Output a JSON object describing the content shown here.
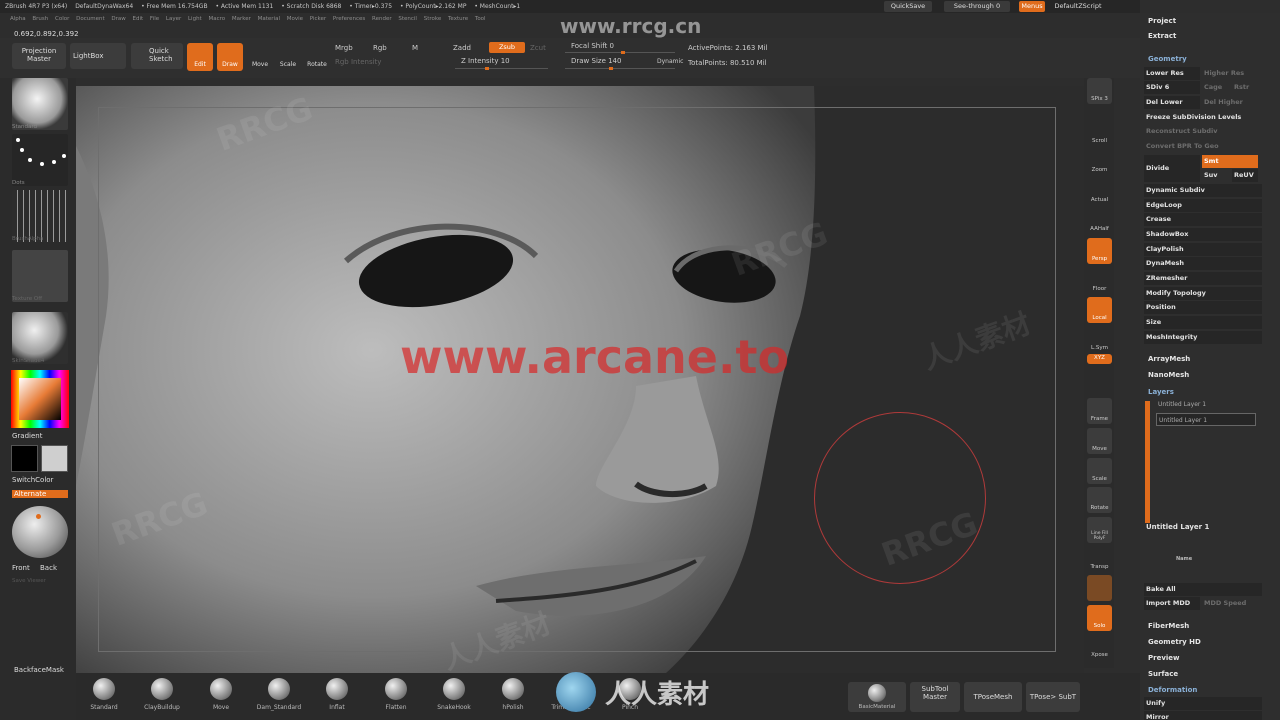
{
  "menubar": {
    "title": "ZBrush 4R7 P3 (x64)",
    "doc": "DefaultDynaWax64",
    "info": [
      "• Free Mem 16.754GB",
      "• Active Mem 1131",
      "• Scratch Disk 6868",
      "• Timer▸0.375",
      "• PolyCount▸2.162 MP",
      "• MeshCount▸1"
    ],
    "menus": [
      "Alpha",
      "Brush",
      "Color",
      "Document",
      "Draw",
      "Edit",
      "File",
      "Layer",
      "Light",
      "Macro",
      "Marker",
      "Material",
      "Movie",
      "Picker",
      "Preferences",
      "Render",
      "Stencil",
      "Stroke",
      "Texture",
      "Tool"
    ],
    "quicksave": "QuickSave",
    "seethrough": "See-through  0",
    "menus_btn": "Menus",
    "defaultzscript": "DefaultZScript"
  },
  "coords": "0.692,0.892,0.392",
  "toolbar": {
    "projection": "Projection Master",
    "lightbox": "LightBox",
    "quicksketch": "Quick Sketch",
    "edit": "Edit",
    "draw": "Draw",
    "move": "Move",
    "scale": "Scale",
    "rotate": "Rotate",
    "mrgb": "Mrgb",
    "rgb": "Rgb",
    "m": "M",
    "rgb_intensity": "Rgb Intensity",
    "zadd": "Zadd",
    "zsub": "Zsub",
    "zcut": "Zcut",
    "z_intensity": "Z Intensity 10",
    "focal": "Focal Shift 0",
    "drawsize": "Draw Size 140",
    "dynamic": "Dynamic",
    "active_points": "ActivePoints: 2.163  Mil",
    "total_points": "TotalPoints: 80.510  Mil"
  },
  "left": {
    "brush": "Standard",
    "stroke": "Dots",
    "alpha": "BrushAlpha",
    "texture": "Texture Off",
    "material": "SkinShade4",
    "gradient": "Gradient",
    "switchcolor": "SwitchColor",
    "alternate": "Alternate",
    "front": "Front",
    "back": "Back",
    "save_viewer": "Save Viewer",
    "backface": "BackfaceMask"
  },
  "right_shelf": [
    "SPix 3",
    "Scroll",
    "Zoom",
    "Actual",
    "AAHalf",
    "Persp",
    "Floor",
    "Local",
    "L.Sym",
    "XYZ",
    "Frame",
    "Move",
    "Scale",
    "Rotate",
    "Line Fill PolyF",
    "Transp",
    "Solo",
    "Xpose"
  ],
  "right_panel": {
    "project": "Project",
    "extract": "Extract",
    "geometry": "Geometry",
    "lower_res": "Lower Res",
    "higher_res": "Higher Res",
    "sdiv": "SDiv 6",
    "cage": "Cage",
    "rstr": "Rstr",
    "del_lower": "Del Lower",
    "del_higher": "Del Higher",
    "freeze": "Freeze SubDivision Levels",
    "reconstruct": "Reconstruct Subdiv",
    "convert": "Convert BPR To Geo",
    "divide": "Divide",
    "smt": "Smt",
    "suv": "Suv",
    "reuv": "ReUV",
    "items": [
      "Dynamic Subdiv",
      "EdgeLoop",
      "Crease",
      "ShadowBox",
      "ClayPolish",
      "DynaMesh",
      "ZRemesher",
      "Modify Topology",
      "Position",
      "Size",
      "MeshIntegrity"
    ],
    "arraymesh": "ArrayMesh",
    "nanomesh": "NanoMesh",
    "layers": "Layers",
    "layer1": "Untitled Layer 1",
    "layer2": "Untitled Layer 1",
    "layer_rec": "REC",
    "layer_name": "Untitled Layer 1",
    "name_btn": "Name",
    "bake_all": "Bake All",
    "import_mdd": "Import MDD",
    "mdd_speed": "MDD Speed",
    "fibermesh": "FiberMesh",
    "geometry_hd": "Geometry HD",
    "preview": "Preview",
    "surface": "Surface",
    "deformation": "Deformation",
    "unify": "Unify",
    "mirror": "Mirror"
  },
  "bottom": {
    "brushes": [
      "Standard",
      "ClayBuildup",
      "Move",
      "Dam_Standard",
      "Inflat",
      "Flatten",
      "SnakeHook",
      "hPolish",
      "TrimDynamic",
      "Pinch"
    ],
    "basic_material": "BasicMaterial",
    "subtool_master": "SubTool Master",
    "tpose_mesh": "TPoseMesh",
    "tpose_subt": "TPose> SubT"
  },
  "watermarks": {
    "rrcg_url": "www.rrcg.cn",
    "arcane": "www.arcane.to",
    "rrcg": "RRCG",
    "cn": "人人素材"
  },
  "colors": {
    "accent": "#e06c1c",
    "panel": "#2e2e2e"
  }
}
